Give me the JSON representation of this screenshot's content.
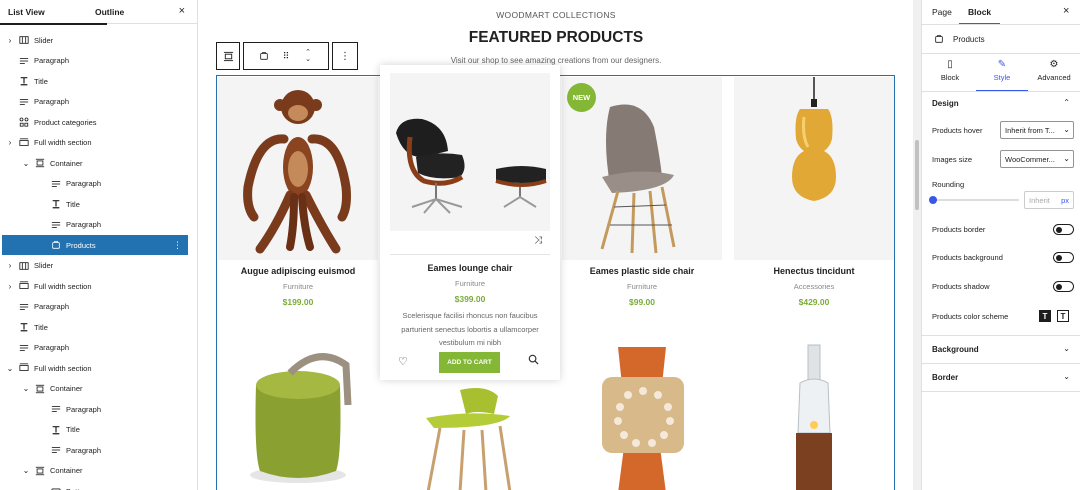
{
  "left_panel": {
    "tabs": [
      "List View",
      "Outline"
    ],
    "close": "×",
    "tree": [
      {
        "label": "Slider",
        "icon": "slider",
        "chev": "›"
      },
      {
        "label": "Paragraph",
        "icon": "paragraph",
        "chev": ""
      },
      {
        "label": "Title",
        "icon": "title",
        "chev": ""
      },
      {
        "label": "Paragraph",
        "icon": "paragraph",
        "chev": ""
      },
      {
        "label": "Product categories",
        "icon": "grid",
        "chev": ""
      },
      {
        "label": "Full width section",
        "icon": "section",
        "chev": "›"
      },
      {
        "label": "Container",
        "icon": "container",
        "chev": "⌄"
      },
      {
        "label": "Paragraph",
        "icon": "paragraph",
        "chev": ""
      },
      {
        "label": "Title",
        "icon": "title",
        "chev": ""
      },
      {
        "label": "Paragraph",
        "icon": "paragraph",
        "chev": ""
      },
      {
        "label": "Products",
        "icon": "products",
        "chev": "",
        "selected": true
      },
      {
        "label": "Slider",
        "icon": "slider",
        "chev": "›"
      },
      {
        "label": "Full width section",
        "icon": "section",
        "chev": "›"
      },
      {
        "label": "Paragraph",
        "icon": "paragraph",
        "chev": ""
      },
      {
        "label": "Title",
        "icon": "title",
        "chev": ""
      },
      {
        "label": "Paragraph",
        "icon": "paragraph",
        "chev": ""
      },
      {
        "label": "Full width section",
        "icon": "section",
        "chev": "⌄"
      },
      {
        "label": "Container",
        "icon": "container",
        "chev": "⌄"
      },
      {
        "label": "Paragraph",
        "icon": "paragraph",
        "chev": ""
      },
      {
        "label": "Title",
        "icon": "title",
        "chev": ""
      },
      {
        "label": "Paragraph",
        "icon": "paragraph",
        "chev": ""
      },
      {
        "label": "Container",
        "icon": "container",
        "chev": "⌄"
      },
      {
        "label": "Button",
        "icon": "button",
        "chev": ""
      }
    ]
  },
  "canvas": {
    "subtitle": "WOODMART COLLECTIONS",
    "title": "FEATURED PRODUCTS",
    "description": "Visit our shop to see amazing creations from our designers.",
    "products": [
      {
        "name": "Augue adipiscing euismod",
        "category": "Furniture",
        "price": "$199.00"
      },
      {
        "name": "Eames lounge chair",
        "category": "Furniture",
        "price": "$399.00",
        "description": "Scelerisque facilisi rhoncus non faucibus parturient senectus lobortis a ullamcorper vestibulum mi nibh",
        "cart_label": "ADD TO CART"
      },
      {
        "name": "Eames plastic side chair",
        "category": "Furniture",
        "price": "$99.00",
        "badge": "NEW"
      },
      {
        "name": "Henectus tincidunt",
        "category": "Accessories",
        "price": "$429.00"
      }
    ]
  },
  "right_panel": {
    "tabs": [
      "Page",
      "Block"
    ],
    "close": "×",
    "block_title": "Products",
    "subtabs": [
      "Block",
      "Style",
      "Advanced"
    ],
    "design_label": "Design",
    "fields": {
      "products_hover_label": "Products hover",
      "products_hover_value": "Inherit from T...",
      "images_size_label": "Images size",
      "images_size_value": "WooCommer...",
      "rounding_label": "Rounding",
      "rounding_placeholder": "Inherit",
      "rounding_unit": "px",
      "products_border": "Products border",
      "products_background": "Products background",
      "products_shadow": "Products shadow",
      "products_color_scheme": "Products color scheme"
    },
    "background_label": "Background",
    "border_label": "Border"
  }
}
